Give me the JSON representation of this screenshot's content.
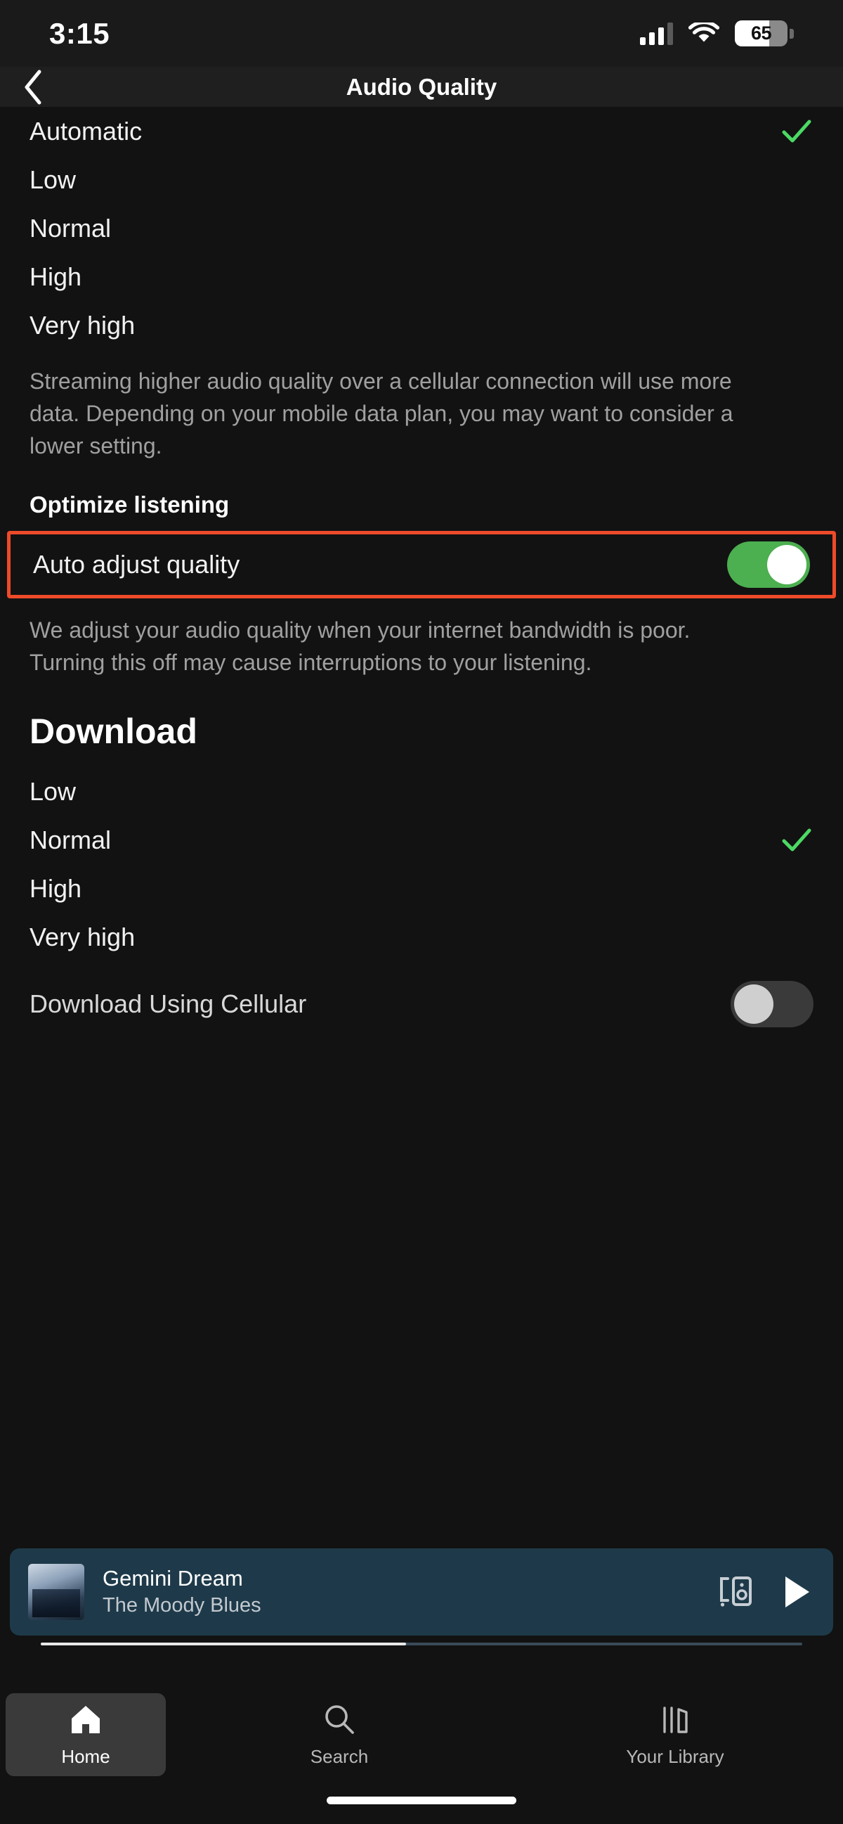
{
  "status_bar": {
    "time": "3:15",
    "battery_percent": "65",
    "battery_level": 65,
    "cellular_icon": "cellular-signal-icon",
    "wifi_icon": "wifi-icon",
    "battery_icon": "battery-icon"
  },
  "nav": {
    "back_icon": "chevron-left-icon",
    "title": "Audio Quality"
  },
  "streaming": {
    "options": [
      {
        "label": "Automatic",
        "selected": true
      },
      {
        "label": "Low",
        "selected": false
      },
      {
        "label": "Normal",
        "selected": false
      },
      {
        "label": "High",
        "selected": false
      },
      {
        "label": "Very high",
        "selected": false
      }
    ],
    "description": "Streaming higher audio quality over a cellular connection will use more data. Depending on your mobile data plan, you may want to consider a lower setting."
  },
  "optimize": {
    "heading": "Optimize listening",
    "toggle_label": "Auto adjust quality",
    "toggle_on": true,
    "description": "We adjust your audio quality when your internet bandwidth is poor. Turning this off may cause interruptions to your listening.",
    "highlight_color": "#ef4a2a",
    "toggle_on_color": "#4caf50"
  },
  "download": {
    "heading": "Download",
    "options": [
      {
        "label": "Low",
        "selected": false
      },
      {
        "label": "Normal",
        "selected": true
      },
      {
        "label": "High",
        "selected": false
      },
      {
        "label": "Very high",
        "selected": false
      }
    ],
    "cellular_label": "Download Using Cellular",
    "cellular_toggle_on": false
  },
  "now_playing": {
    "title": "Gemini Dream",
    "artist": "The Moody Blues",
    "connect_icon": "connect-to-device-icon",
    "play_icon": "play-icon",
    "album_art": "album-artwork",
    "progress_percent": 48
  },
  "tab_bar": {
    "tabs": [
      {
        "label": "Home",
        "icon": "home-icon",
        "active": true
      },
      {
        "label": "Search",
        "icon": "search-icon",
        "active": false
      },
      {
        "label": "Your Library",
        "icon": "library-icon",
        "active": false
      }
    ]
  },
  "colors": {
    "background": "#121212",
    "accent_green": "#4caf50",
    "check_green": "#4cd964",
    "highlight_red": "#ef4a2a",
    "now_playing_bg": "#1e3a4a"
  }
}
